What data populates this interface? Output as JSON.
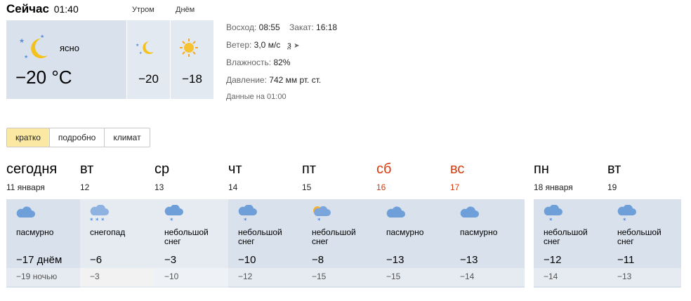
{
  "now": {
    "title": "Сейчас",
    "time": "01:40",
    "condition": "ясно",
    "temp": "−20 °C",
    "morning_label": "Утром",
    "day_label": "Днём",
    "morning_temp": "−20",
    "day_temp": "−18",
    "icon": "night-clear-moon-icon",
    "morning_icon": "moon-icon",
    "day_icon": "sun-icon"
  },
  "details": {
    "sunrise_label": "Восход:",
    "sunrise": "08:55",
    "sunset_label": "Закат:",
    "sunset": "16:18",
    "wind_label": "Ветер:",
    "wind": "3,0 м/с",
    "wind_dir": "з",
    "humidity_label": "Влажность:",
    "humidity": "82%",
    "pressure_label": "Давление:",
    "pressure": "742 мм рт. ст.",
    "note": "Данные на 01:00"
  },
  "tabs": [
    "кратко",
    "подробно",
    "климат"
  ],
  "active_tab": "кратко",
  "forecast": [
    {
      "name": "сегодня",
      "date": "11 января",
      "cond1": "пасмурно",
      "cond2": "",
      "hi": "−17 днём",
      "lo": "−19 ночью",
      "icon": "cloud-icon",
      "weekend": false
    },
    {
      "name": "вт",
      "date": "12",
      "cond1": "снегопад",
      "cond2": "",
      "hi": "−6",
      "lo": "−3",
      "icon": "snow-cloud-icon",
      "weekend": false
    },
    {
      "name": "ср",
      "date": "13",
      "cond1": "небольшой",
      "cond2": "снег",
      "hi": "−3",
      "lo": "−10",
      "icon": "light-snow-icon",
      "weekend": false
    },
    {
      "name": "чт",
      "date": "14",
      "cond1": "небольшой",
      "cond2": "снег",
      "hi": "−10",
      "lo": "−12",
      "icon": "light-snow-icon",
      "weekend": false
    },
    {
      "name": "пт",
      "date": "15",
      "cond1": "небольшой",
      "cond2": "снег",
      "hi": "−8",
      "lo": "−15",
      "icon": "sun-cloud-snow-icon",
      "weekend": false
    },
    {
      "name": "сб",
      "date": "16",
      "cond1": "пасмурно",
      "cond2": "",
      "hi": "−13",
      "lo": "−15",
      "icon": "cloud-icon",
      "weekend": true
    },
    {
      "name": "вс",
      "date": "17",
      "cond1": "пасмурно",
      "cond2": "",
      "hi": "−13",
      "lo": "−14",
      "icon": "cloud-icon",
      "weekend": true
    },
    {
      "name": "пн",
      "date": "18 января",
      "cond1": "небольшой",
      "cond2": "снег",
      "hi": "−12",
      "lo": "−14",
      "icon": "light-snow-icon",
      "weekend": false
    },
    {
      "name": "вт",
      "date": "19",
      "cond1": "небольшой",
      "cond2": "снег",
      "hi": "−11",
      "lo": "−13",
      "icon": "light-snow-icon",
      "weekend": false
    }
  ],
  "colors": {
    "weekend": "#d63a0c",
    "tab_active": "#fbe9a3",
    "card_bg": "#e6ebf1",
    "card_alt_bg": "#d9e2ec"
  }
}
